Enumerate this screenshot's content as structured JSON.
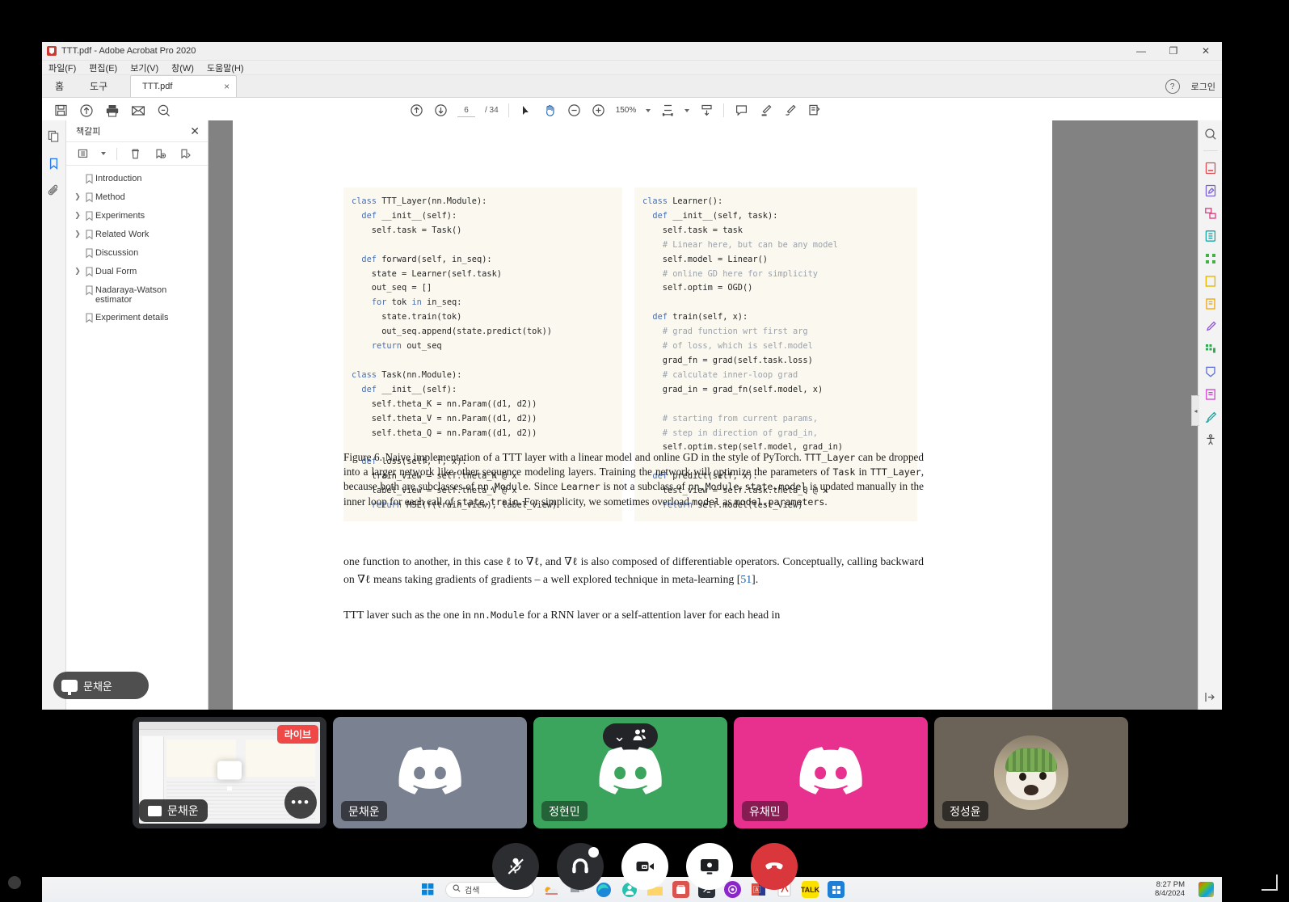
{
  "acrobat": {
    "window_title": "TTT.pdf - Adobe Acrobat Pro 2020",
    "app_icon": "acrobat-icon",
    "window_buttons": {
      "minimize": "—",
      "maximize": "❐",
      "close": "✕"
    },
    "menus": [
      "파일(F)",
      "편집(E)",
      "보기(V)",
      "창(W)",
      "도움말(H)"
    ],
    "tabs": {
      "home": "홈",
      "tools": "도구",
      "document": "TTT.pdf",
      "close_glyph": "×"
    },
    "help_glyph": "?",
    "login_label": "로그인",
    "toolbar": {
      "save_icon": "save-icon",
      "upload_icon": "upload-cloud-icon",
      "print_icon": "print-icon",
      "email_icon": "email-icon",
      "search_icon": "search-icon",
      "page_up_icon": "page-up-icon",
      "page_down_icon": "page-down-icon",
      "current_page": "6",
      "page_total": "/ 34",
      "select_icon": "cursor-select-icon",
      "hand_icon": "hand-tool-icon",
      "zoom_out_icon": "zoom-out-icon",
      "zoom_in_icon": "zoom-in-icon",
      "zoom_level": "150%",
      "fit_page_icon": "fit-page-icon",
      "scroll_mode_icon": "scroll-mode-icon",
      "comment_icon": "comment-icon",
      "highlight_icon": "highlight-icon",
      "draw_icon": "draw-icon",
      "stamp_icon": "stamp-icon"
    },
    "left_rail": [
      "page-thumbnails-icon",
      "bookmarks-icon",
      "attachments-icon"
    ],
    "bookmarks": {
      "title": "책갈피",
      "close_glyph": "✕",
      "tools": [
        "bookmark-options-icon",
        "delete-bookmark-icon",
        "new-bookmark-icon",
        "edit-bookmark-icon"
      ],
      "items": [
        {
          "label": "Introduction",
          "expandable": false
        },
        {
          "label": "Method",
          "expandable": true
        },
        {
          "label": "Experiments",
          "expandable": true
        },
        {
          "label": "Related Work",
          "expandable": true
        },
        {
          "label": "Discussion",
          "expandable": false
        },
        {
          "label": "Dual Form",
          "expandable": true
        },
        {
          "label": "Nadaraya-Watson estimator",
          "expandable": false
        },
        {
          "label": "Experiment details",
          "expandable": false
        }
      ]
    },
    "right_rail": [
      "search-tool-icon",
      "export-pdf-icon",
      "edit-pdf-icon",
      "create-pdf-icon",
      "combine-files-icon",
      "organize-pages-icon",
      "redact-icon",
      "protect-icon",
      "fill-sign-icon",
      "send-for-comments-icon",
      "more-tools-icon",
      "certificate-icon",
      "compare-files-icon",
      "accessibility-icon"
    ],
    "collapse_glyph": "◂",
    "share_overlay": {
      "icon": "screen-share-icon",
      "name": "문채운"
    }
  },
  "document": {
    "code_left": [
      {
        "t": "kw",
        "s": "class"
      },
      {
        "t": "p",
        "s": " TTT_Layer(nn.Module):\n  "
      },
      {
        "t": "kw",
        "s": "def"
      },
      {
        "t": "p",
        "s": " __init__(self):\n    self.task = Task()\n\n  "
      },
      {
        "t": "kw",
        "s": "def"
      },
      {
        "t": "p",
        "s": " forward(self, in_seq):\n    state = Learner(self.task)\n    out_seq = []\n    "
      },
      {
        "t": "kw",
        "s": "for"
      },
      {
        "t": "p",
        "s": " tok "
      },
      {
        "t": "kw",
        "s": "in"
      },
      {
        "t": "p",
        "s": " in_seq:\n      state.train(tok)\n      out_seq.append(state.predict(tok))\n    "
      },
      {
        "t": "kw",
        "s": "return"
      },
      {
        "t": "p",
        "s": " out_seq\n\n"
      },
      {
        "t": "kw",
        "s": "class"
      },
      {
        "t": "p",
        "s": " Task(nn.Module):\n  "
      },
      {
        "t": "kw",
        "s": "def"
      },
      {
        "t": "p",
        "s": " __init__(self):\n    self.theta_K = nn.Param((d1, d2))\n    self.theta_V = nn.Param((d1, d2))\n    self.theta_Q = nn.Param((d1, d2))\n\n  "
      },
      {
        "t": "kw",
        "s": "def"
      },
      {
        "t": "p",
        "s": " loss(self, f, x):\n    train_view = self.theta_K @ x\n    label_view = self.theta_V @ x\n    "
      },
      {
        "t": "kw",
        "s": "return"
      },
      {
        "t": "p",
        "s": " MSE(f(train_view), label_view)"
      }
    ],
    "code_right": [
      {
        "t": "kw",
        "s": "class"
      },
      {
        "t": "p",
        "s": " Learner():\n  "
      },
      {
        "t": "kw",
        "s": "def"
      },
      {
        "t": "p",
        "s": " __init__(self, task):\n    self.task = task\n    "
      },
      {
        "t": "cm",
        "s": "# Linear here, but can be any model"
      },
      {
        "t": "p",
        "s": "\n    self.model = Linear()\n    "
      },
      {
        "t": "cm",
        "s": "# online GD here for simplicity"
      },
      {
        "t": "p",
        "s": "\n    self.optim = OGD()\n\n  "
      },
      {
        "t": "kw",
        "s": "def"
      },
      {
        "t": "p",
        "s": " train(self, x):\n    "
      },
      {
        "t": "cm",
        "s": "# grad function wrt first arg\n    # of loss, which is self.model"
      },
      {
        "t": "p",
        "s": "\n    grad_fn = grad(self.task.loss)\n    "
      },
      {
        "t": "cm",
        "s": "# calculate inner-loop grad"
      },
      {
        "t": "p",
        "s": "\n    grad_in = grad_fn(self.model, x)\n\n    "
      },
      {
        "t": "cm",
        "s": "# starting from current params,\n    # step in direction of grad_in,"
      },
      {
        "t": "p",
        "s": "\n    self.optim.step(self.model, grad_in)\n\n  "
      },
      {
        "t": "kw",
        "s": "def"
      },
      {
        "t": "p",
        "s": " predict(self, x):\n    test_view = self.task.theta_Q @ x\n    "
      },
      {
        "t": "kw",
        "s": "return"
      },
      {
        "t": "p",
        "s": " self.model(test_view)"
      }
    ],
    "caption_html": "Figure 6. Naive implementation of a TTT layer with a linear model and online GD in the style of PyTorch. <span class=\"mono\">TTT_Layer</span> can be dropped into a larger network like other sequence modeling layers. Training the network will optimize the parameters of <span class=\"mono\">Task</span> in <span class=\"mono\">TTT_Layer</span>, because both are subclasses of <span class=\"mono\">nn.Module</span>. Since <span class=\"mono\">Learner</span> is not a subclass of <span class=\"mono\">nn.Module</span>, <span class=\"mono\">state.model</span> is updated manually in the inner loop for each call of <span class=\"mono\">state.train</span>. For simplicity, we sometimes overload <span class=\"mono\">model</span> as <span class=\"mono\">model.parameters</span>.",
    "paragraph_html": "one function to another, in this case &#8467; to &nabla;&#8467;, and &nabla;&#8467; is also composed of differentiable operators. Conceptually, calling backward on &nabla;&#8467; means taking gradients of gradients &ndash; a well explored technique in meta-learning [<span class=\"cite\">51</span>].",
    "cut_line_html": "TTT layer such as the one in <span class=\"mono\">nn.Module</span> for a RNN layer or a self-attention layer for each head in"
  },
  "taskbar": {
    "start_icon": "windows-start-icon",
    "search_placeholder": "검색",
    "search_icon": "search-icon",
    "pinned": [
      "weather-icon",
      "task-view-icon",
      "edge-icon",
      "teams-icon",
      "file-explorer-icon",
      "store-icon",
      "terminal-icon",
      "github-icon",
      "vscode-icon",
      "acrobat-icon",
      "kakaotalk-icon",
      "settings-icon"
    ],
    "clock_time": "8:27 PM",
    "clock_date": "8/4/2024",
    "tray_icon": "notification-icon"
  },
  "call": {
    "tiles": [
      {
        "name": "문채운",
        "kind": "screenshare",
        "badge": "라이브",
        "color": "#2b2d31",
        "more_glyph": "•••",
        "icon": "screen-share-icon"
      },
      {
        "name": "문채운",
        "kind": "avatar",
        "color": "#7a8291",
        "icon": "discord-logo-icon"
      },
      {
        "name": "정현민",
        "kind": "avatar",
        "color": "#3ba55d",
        "icon": "discord-logo-icon",
        "top_pill": {
          "chevron": "⌄",
          "icon": "participants-icon"
        }
      },
      {
        "name": "유채민",
        "kind": "avatar",
        "color": "#e8318f",
        "icon": "discord-logo-icon"
      },
      {
        "name": "정성윤",
        "kind": "photo",
        "color": "#6b6258",
        "icon": "dog-avatar-icon"
      }
    ],
    "controls": [
      {
        "name": "mute-mic-button",
        "icon": "mic-muted-icon",
        "style": "dark"
      },
      {
        "name": "deafen-button",
        "icon": "headphones-icon",
        "style": "dark"
      },
      {
        "name": "video-button",
        "icon": "camera-off-icon",
        "style": "light"
      },
      {
        "name": "screen-share-button",
        "icon": "screen-share-icon",
        "style": "light"
      },
      {
        "name": "end-call-button",
        "icon": "hang-up-icon",
        "style": "red"
      }
    ]
  }
}
